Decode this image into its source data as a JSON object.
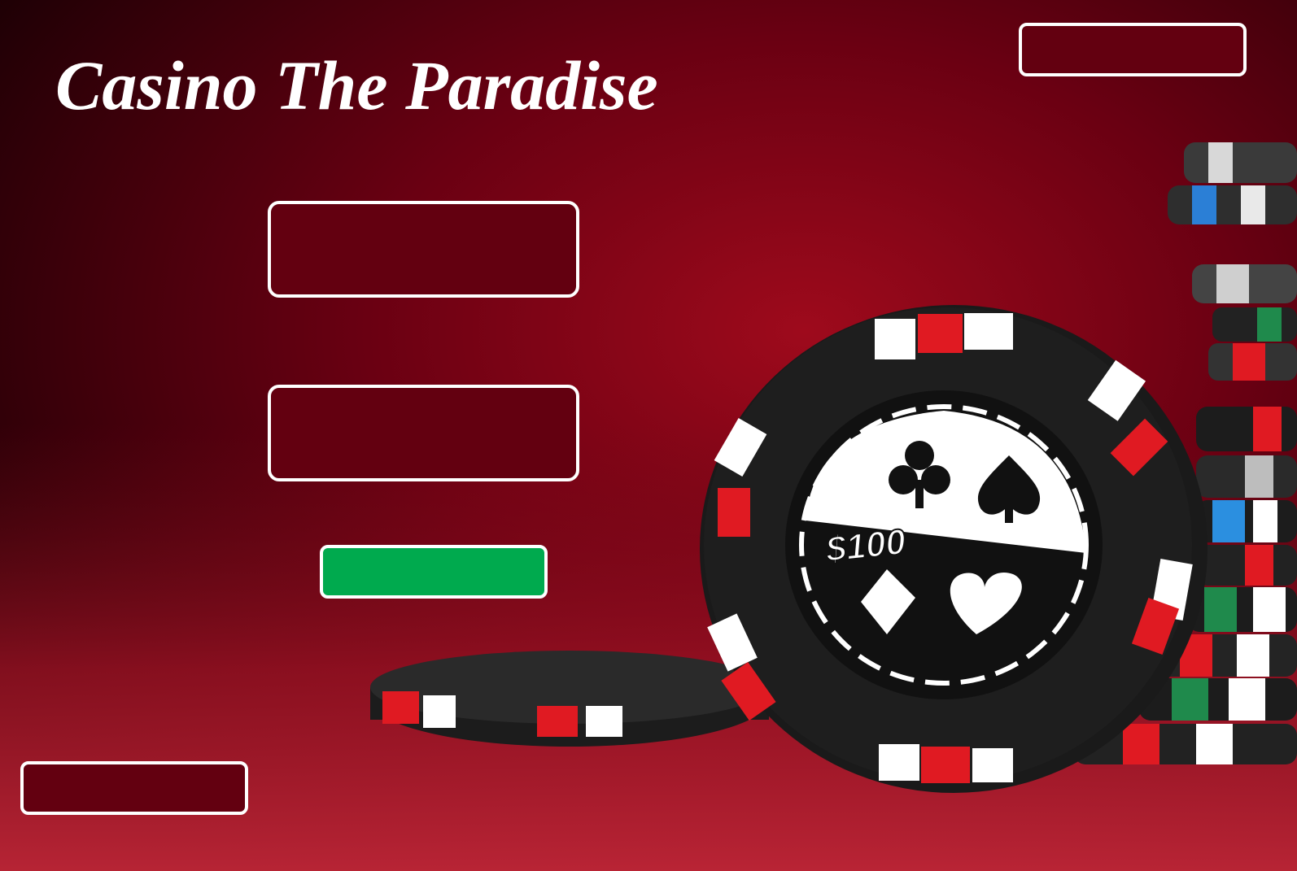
{
  "app": {
    "title": "Casino The Paradise"
  },
  "buttons": {
    "top_right_label": "",
    "field_one_label": "",
    "field_two_label": "",
    "green_label": "",
    "bottom_left_label": ""
  },
  "chip": {
    "value_label": "$100",
    "suits": [
      "club-icon",
      "spade-icon",
      "diamond-icon",
      "heart-icon"
    ]
  },
  "colors": {
    "background": "#6a0012",
    "button_fill": "#630010",
    "button_border": "#ffffff",
    "green_button": "#00aa4e",
    "chip_red": "#e01a22",
    "chip_black": "#1c1c1c"
  }
}
